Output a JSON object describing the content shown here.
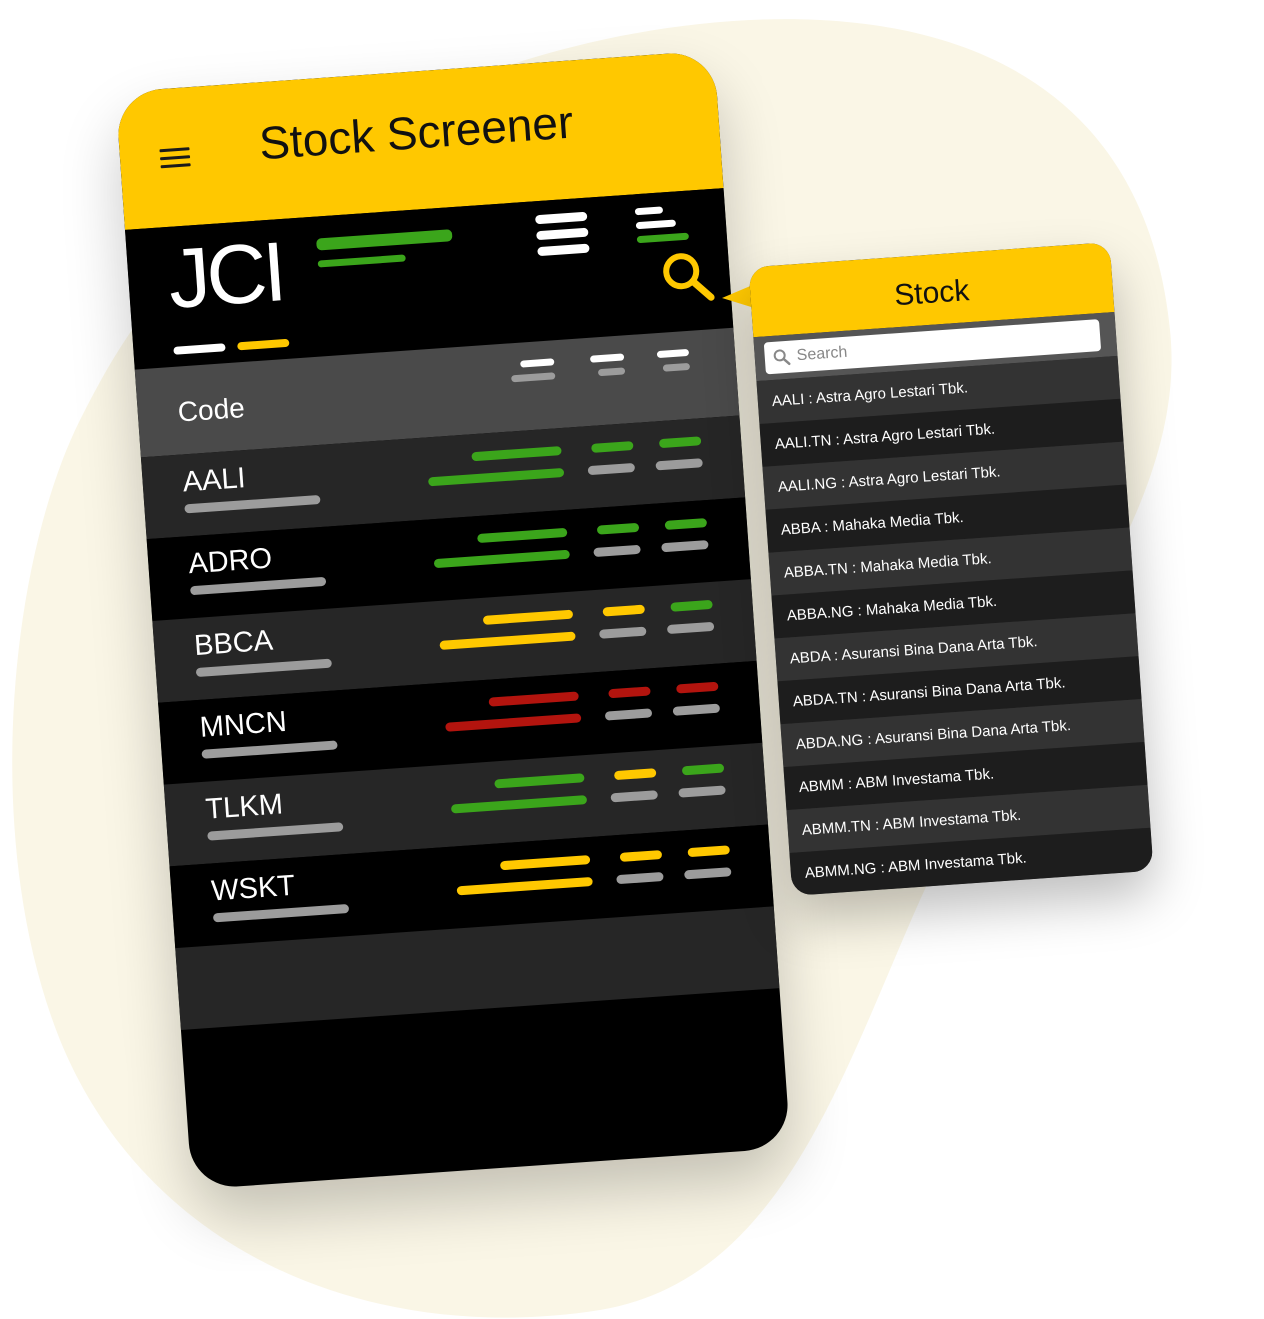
{
  "app": {
    "title": "Stock Screener"
  },
  "index": {
    "name": "JCI"
  },
  "table": {
    "header_label": "Code",
    "rows": [
      {
        "code": "AALI",
        "status": "up"
      },
      {
        "code": "ADRO",
        "status": "up"
      },
      {
        "code": "BBCA",
        "status": "flat"
      },
      {
        "code": "MNCN",
        "status": "down"
      },
      {
        "code": "TLKM",
        "status": "mixed"
      },
      {
        "code": "WSKT",
        "status": "flat"
      }
    ]
  },
  "stock_panel": {
    "title": "Stock",
    "search_placeholder": "Search",
    "items": [
      {
        "code": "AALI",
        "name": "Astra Agro Lestari Tbk."
      },
      {
        "code": "AALI.TN",
        "name": "Astra Agro Lestari Tbk."
      },
      {
        "code": "AALI.NG",
        "name": "Astra Agro Lestari Tbk."
      },
      {
        "code": "ABBA",
        "name": "Mahaka Media Tbk."
      },
      {
        "code": "ABBA.TN",
        "name": "Mahaka Media Tbk."
      },
      {
        "code": "ABBA.NG",
        "name": "Mahaka Media Tbk."
      },
      {
        "code": "ABDA",
        "name": "Asuransi Bina Dana Arta Tbk."
      },
      {
        "code": "ABDA.TN",
        "name": "Asuransi Bina Dana Arta Tbk."
      },
      {
        "code": "ABDA.NG",
        "name": "Asuransi Bina Dana Arta Tbk."
      },
      {
        "code": "ABMM",
        "name": "ABM Investama Tbk."
      },
      {
        "code": "ABMM.TN",
        "name": "ABM Investama Tbk."
      },
      {
        "code": "ABMM.NG",
        "name": "ABM Investama Tbk."
      }
    ]
  },
  "colors": {
    "accent": "#ffc800",
    "up": "#3ba51b",
    "down": "#b3140e",
    "neutral": "#9c9c9c",
    "background_blob": "#faf6e6"
  },
  "icons": [
    "menu-icon",
    "search-icon"
  ]
}
